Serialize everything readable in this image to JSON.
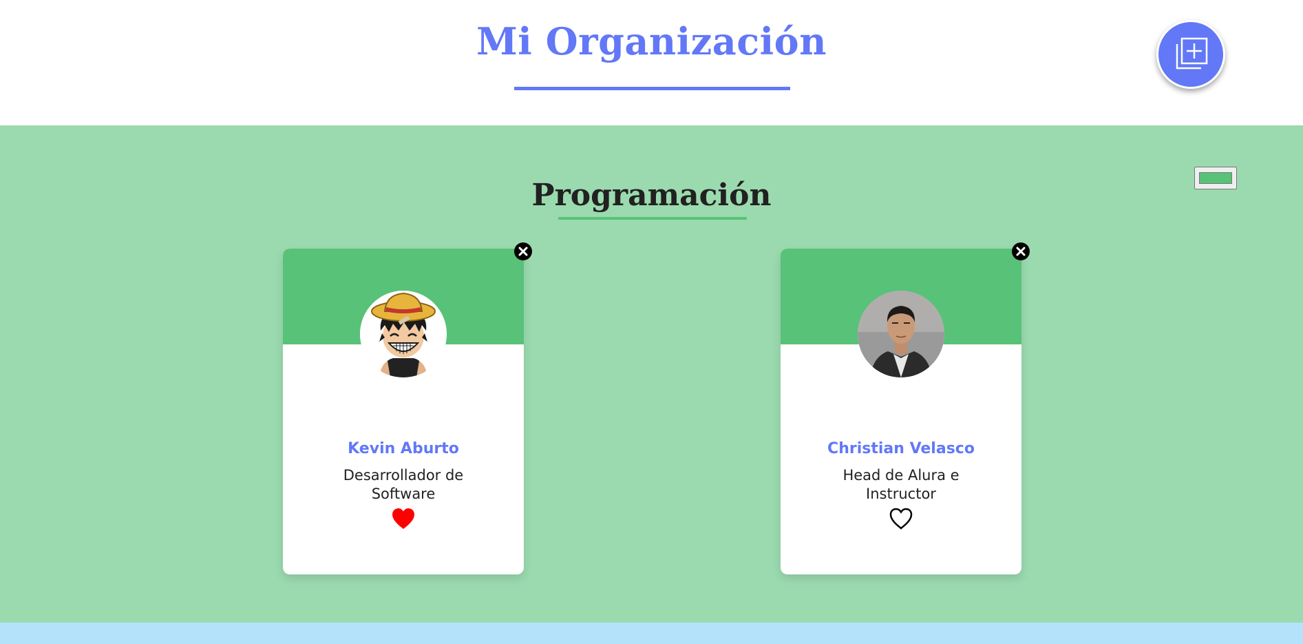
{
  "header": {
    "title": "Mi Organización",
    "add_button_icon": "add-to-queue-icon",
    "accent_color": "#6278F7"
  },
  "team": {
    "title": "Programación",
    "primary_color": "#57C278",
    "secondary_color": "#9BDAAF",
    "color_picker_value": "#57C278",
    "members": [
      {
        "name": "Kevin Aburto",
        "role": "Desarrollador de Software",
        "favorite": true,
        "avatar": "cartoon-avatar"
      },
      {
        "name": "Christian Velasco",
        "role": "Head de Alura e Instructor",
        "favorite": false,
        "avatar": "photo-avatar"
      }
    ]
  },
  "next_section_color": "#B4E2FB"
}
